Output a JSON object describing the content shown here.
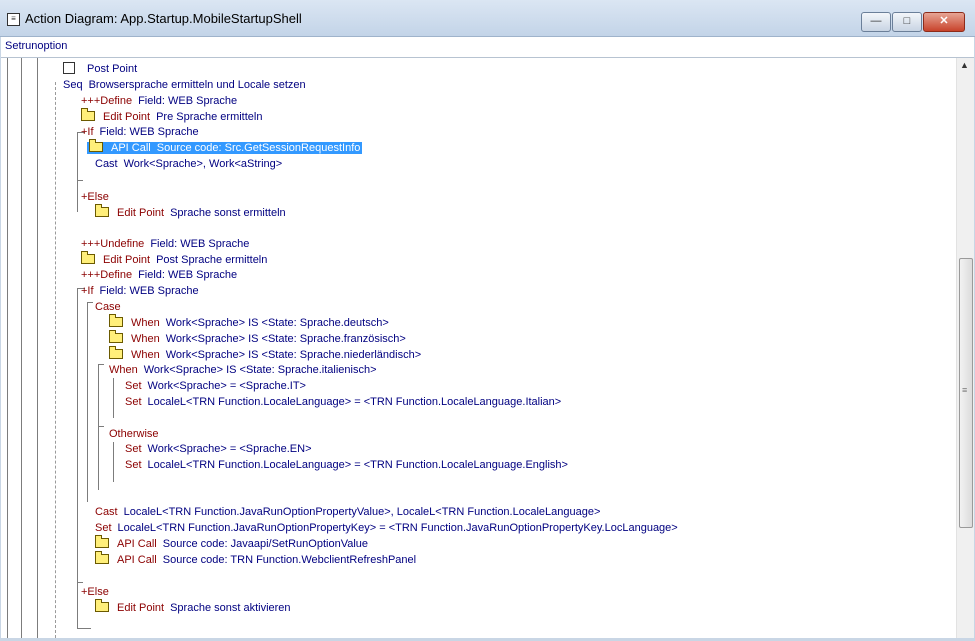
{
  "window": {
    "title": "Action Diagram: App.Startup.MobileStartupShell",
    "subtitle": "Setrunoption",
    "buttons": {
      "minimize": "—",
      "maximize": "□",
      "close": "✕"
    }
  },
  "colors": {
    "keyword": "#8b0000",
    "text": "#000080",
    "selection": "#3399ff",
    "folder": "#ffef7a"
  },
  "rows": [
    {
      "kw": "Post Point",
      "text": "",
      "icon": "doc-icon"
    },
    {
      "kw": "Seq",
      "text": "Browsersprache ermitteln und Locale setzen",
      "icon": ""
    },
    {
      "kw": "+++Define",
      "text": "Field: WEB Sprache",
      "icon": ""
    },
    {
      "kw": "Edit Point",
      "text": "Pre Sprache ermitteln",
      "icon": "folder-icon"
    },
    {
      "kw": "+If",
      "text": "Field: WEB Sprache",
      "icon": ""
    },
    {
      "kw": "API Call",
      "text": "Source code: Src.GetSessionRequestInfo",
      "icon": "folder-icon"
    },
    {
      "kw": "Cast",
      "text": "Work<Sprache>, Work<aString>",
      "icon": ""
    },
    {
      "kw": "+Else",
      "text": "",
      "icon": ""
    },
    {
      "kw": "Edit Point",
      "text": "Sprache sonst ermitteln",
      "icon": "folder-icon"
    },
    {
      "kw": "+++Undefine",
      "text": "Field: WEB Sprache",
      "icon": ""
    },
    {
      "kw": "Edit Point",
      "text": "Post Sprache ermitteln",
      "icon": "folder-icon"
    },
    {
      "kw": "+++Define",
      "text": "Field: WEB Sprache",
      "icon": ""
    },
    {
      "kw": "+If",
      "text": "Field: WEB Sprache",
      "icon": ""
    },
    {
      "kw": "Case",
      "text": "",
      "icon": ""
    },
    {
      "kw": "When",
      "text": "Work<Sprache> IS <State: Sprache.deutsch>",
      "icon": "folder-icon"
    },
    {
      "kw": "When",
      "text": "Work<Sprache> IS <State: Sprache.französisch>",
      "icon": "folder-icon"
    },
    {
      "kw": "When",
      "text": "Work<Sprache> IS <State: Sprache.niederländisch>",
      "icon": "folder-icon"
    },
    {
      "kw": "When",
      "text": "Work<Sprache> IS <State: Sprache.italienisch>",
      "icon": ""
    },
    {
      "kw": "Set",
      "text": "Work<Sprache> = <Sprache.IT>",
      "icon": ""
    },
    {
      "kw": "Set",
      "text": "LocaleL<TRN Function.LocaleLanguage> = <TRN Function.LocaleLanguage.Italian>",
      "icon": ""
    },
    {
      "kw": "Otherwise",
      "text": "",
      "icon": ""
    },
    {
      "kw": "Set",
      "text": "Work<Sprache> = <Sprache.EN>",
      "icon": ""
    },
    {
      "kw": "Set",
      "text": "LocaleL<TRN Function.LocaleLanguage> = <TRN Function.LocaleLanguage.English>",
      "icon": ""
    },
    {
      "kw": "Cast",
      "text": "LocaleL<TRN Function.JavaRunOptionPropertyValue>, LocaleL<TRN Function.LocaleLanguage>",
      "icon": ""
    },
    {
      "kw": "Set",
      "text": "LocaleL<TRN Function.JavaRunOptionPropertyKey> = <TRN Function.JavaRunOptionPropertyKey.LocLanguage>",
      "icon": ""
    },
    {
      "kw": "API Call",
      "text": "Source code: Javaapi/SetRunOptionValue",
      "icon": "folder-icon"
    },
    {
      "kw": "API Call",
      "text": "Source code: TRN Function.WebclientRefreshPanel",
      "icon": "folder-icon"
    },
    {
      "kw": "+Else",
      "text": "",
      "icon": ""
    },
    {
      "kw": "Edit Point",
      "text": "Sprache sonst aktivieren",
      "icon": "folder-icon"
    }
  ],
  "scrollbar": {
    "up_arrow": "▲",
    "grip": "≡"
  }
}
